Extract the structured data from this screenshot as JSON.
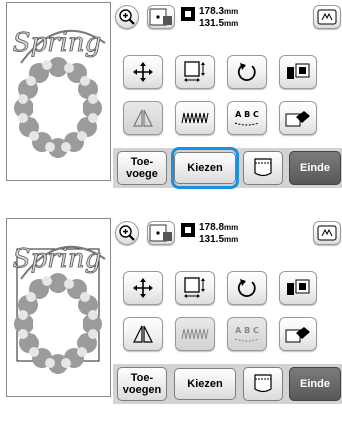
{
  "panel_top": {
    "preview_text": "Spring",
    "width_value": "178.3",
    "height_value": "131.5",
    "unit": "mm",
    "buttons": {
      "add_label": "Toe-\nvoege",
      "select_label": "Kiezen",
      "end_label": "Einde"
    },
    "highlight_color": "#1b8fe0"
  },
  "panel_bottom": {
    "preview_text": "Spring",
    "width_value": "178.8",
    "height_value": "131.5",
    "unit": "mm",
    "buttons": {
      "add_label": "Toe-\nvoegen",
      "select_label": "Kiezen",
      "end_label": "Einde"
    }
  },
  "icons": {
    "zoom": "zoom-in-icon",
    "frame": "embroidery-frame-icon",
    "dimension": "dimension-icon",
    "hoop": "hoop-icon",
    "move": "move-arrows-icon",
    "size": "resize-icon",
    "rotate": "rotate-icon",
    "edit": "edit-letters-icon",
    "mirror": "mirror-icon",
    "density": "density-icon",
    "array": "text-array-icon",
    "delete": "eraser-icon",
    "pocket": "memory-pocket-icon"
  }
}
